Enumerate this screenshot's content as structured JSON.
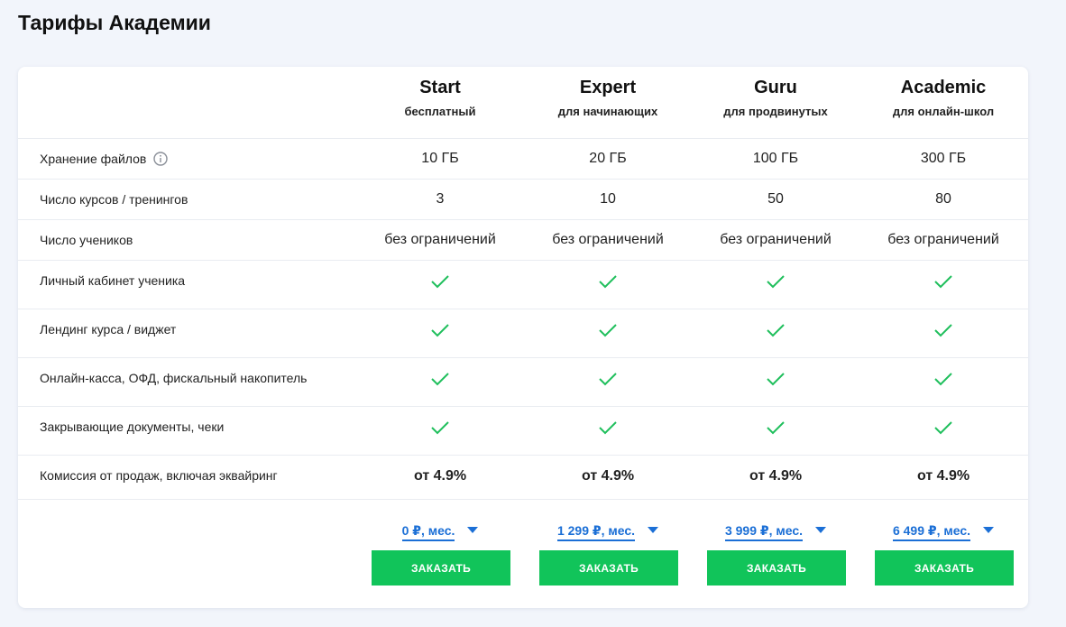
{
  "page": {
    "title": "Тарифы Академии"
  },
  "plans": [
    {
      "name": "Start",
      "subtitle": "бесплатный",
      "price": "0 ₽, мес.",
      "button": "ЗАКАЗАТЬ"
    },
    {
      "name": "Expert",
      "subtitle": "для начинающих",
      "price": "1 299 ₽, мес.",
      "button": "ЗАКАЗАТЬ"
    },
    {
      "name": "Guru",
      "subtitle": "для продвинутых",
      "price": "3 999 ₽, мес.",
      "button": "ЗАКАЗАТЬ"
    },
    {
      "name": "Academic",
      "subtitle": "для онлайн-школ",
      "price": "6 499 ₽, мес.",
      "button": "ЗАКАЗАТЬ"
    }
  ],
  "features": [
    {
      "label": "Хранение файлов",
      "info_icon": "info-circle-icon",
      "type": "text",
      "values": [
        "10 ГБ",
        "20 ГБ",
        "100 ГБ",
        "300 ГБ"
      ]
    },
    {
      "label": "Число курсов / тренингов",
      "type": "text",
      "values": [
        "3",
        "10",
        "50",
        "80"
      ]
    },
    {
      "label": "Число учеников",
      "type": "text",
      "values": [
        "без ограничений",
        "без ограничений",
        "без ограничений",
        "без ограничений"
      ]
    },
    {
      "label": "Личный кабинет ученика",
      "type": "check",
      "values": [
        true,
        true,
        true,
        true
      ]
    },
    {
      "label": "Лендинг курса / виджет",
      "type": "check",
      "values": [
        true,
        true,
        true,
        true
      ]
    },
    {
      "label": "Онлайн-касса, ОФД, фискальный накопитель",
      "type": "check",
      "values": [
        true,
        true,
        true,
        true
      ]
    },
    {
      "label": "Закрывающие документы, чеки",
      "type": "check",
      "values": [
        true,
        true,
        true,
        true
      ]
    },
    {
      "label": "Комиссия от продаж, включая эквайринг",
      "type": "bold",
      "values": [
        "от 4.9%",
        "от 4.9%",
        "от 4.9%",
        "от 4.9%"
      ]
    }
  ],
  "colors": {
    "accent_blue": "#1b6fd6",
    "button_green": "#11c45a",
    "check_green": "#1fbf5c",
    "background": "#f2f5fb"
  }
}
